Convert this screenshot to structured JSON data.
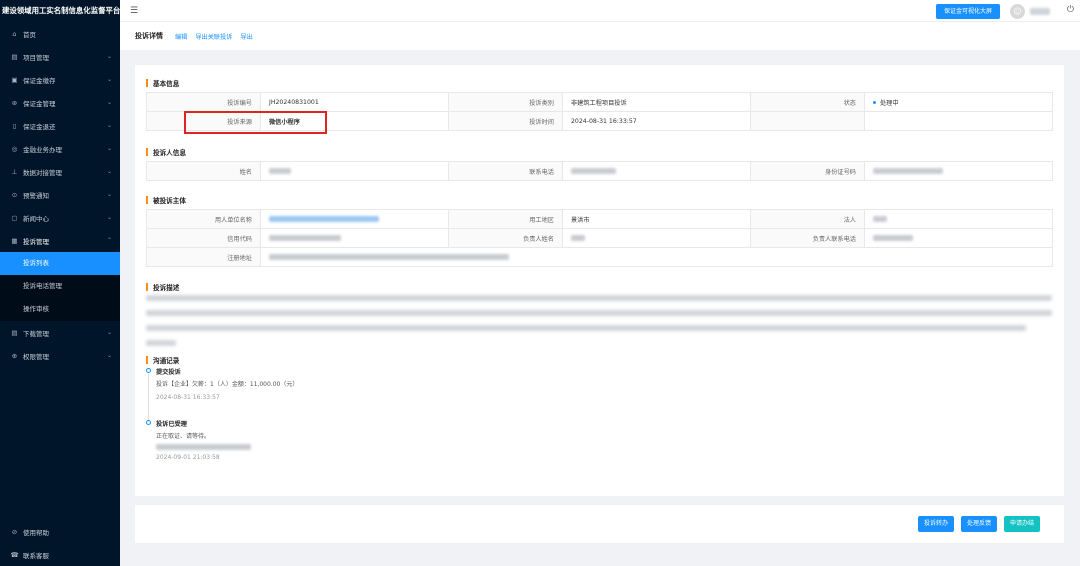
{
  "brand": "建设领域用工实名制信息化监督平台",
  "sidebar": {
    "items": [
      {
        "icon": "home-icon",
        "glyph": "⌂",
        "label": "首页",
        "chevron": ""
      },
      {
        "icon": "project-icon",
        "glyph": "▤",
        "label": "项目管理",
        "chevron": "⌄"
      },
      {
        "icon": "deposit-icon",
        "glyph": "▣",
        "label": "保证金缴存",
        "chevron": "⌄"
      },
      {
        "icon": "deposit-manage-icon",
        "glyph": "⊛",
        "label": "保证金管理",
        "chevron": "⌄"
      },
      {
        "icon": "refund-icon",
        "glyph": "▯",
        "label": "保证金退还",
        "chevron": "⌄"
      },
      {
        "icon": "finance-icon",
        "glyph": "◎",
        "label": "金融业务办理",
        "chevron": "⌄"
      },
      {
        "icon": "data-icon",
        "glyph": "⊥",
        "label": "数据对接管理",
        "chevron": "⌄"
      },
      {
        "icon": "alert-icon",
        "glyph": "⊙",
        "label": "预警通知",
        "chevron": "⌄"
      },
      {
        "icon": "news-icon",
        "glyph": "▢",
        "label": "新闻中心",
        "chevron": "⌄"
      },
      {
        "icon": "complaint-icon",
        "glyph": "▦",
        "label": "投诉管理",
        "chevron": "⌃"
      }
    ],
    "sub_items": [
      {
        "label": "投诉列表",
        "active": true
      },
      {
        "label": "投诉电话管理",
        "active": false
      },
      {
        "label": "操作审核",
        "active": false
      }
    ],
    "items_after": [
      {
        "icon": "download-icon",
        "glyph": "▤",
        "label": "下载管理",
        "chevron": "⌄"
      },
      {
        "icon": "permission-icon",
        "glyph": "⊕",
        "label": "权限管理",
        "chevron": "⌄"
      }
    ],
    "bottom": [
      {
        "icon": "help-icon",
        "glyph": "⊘",
        "label": "使用帮助"
      },
      {
        "icon": "service-icon",
        "glyph": "☎",
        "label": "联系客服"
      }
    ]
  },
  "header": {
    "big_screen_label": "保证金可视化大屏",
    "avatar_glyph": "☺"
  },
  "crumb": {
    "title": "投诉详情",
    "links": [
      "编辑",
      "导出关联投诉",
      "导出"
    ]
  },
  "basic": {
    "title": "基本信息",
    "rows": [
      [
        {
          "label": "投诉编号",
          "value": "JH20240831001"
        },
        {
          "label": "投诉类别",
          "value": "非建筑工程项目投诉"
        },
        {
          "label": "状态",
          "value": "处理中"
        }
      ],
      [
        {
          "label": "投诉来源",
          "value": "微信小程序"
        },
        {
          "label": "投诉时间",
          "value": "2024-08-31 16:33:57"
        },
        {
          "label": "",
          "value": ""
        }
      ]
    ]
  },
  "complainant": {
    "title": "投诉人信息",
    "labels": [
      "姓名",
      "联系电话",
      "身份证号码"
    ]
  },
  "respondent": {
    "title": "被投诉主体",
    "labels_row1": [
      "用人单位名称",
      "用工地区",
      "法人"
    ],
    "labels_row2": [
      "信用代码",
      "负责人姓名",
      "负责人联系电话"
    ],
    "label_row3": "注册地址",
    "region_value": "景洪市"
  },
  "description": {
    "title": "投诉描述"
  },
  "communication": {
    "title": "沟通记录",
    "records": [
      {
        "title": "提交投诉",
        "text": "投诉【企业】欠薪：1（人）金额：11,000.00（元）",
        "time": "2024-08-31 16:33:57"
      },
      {
        "title": "投诉已受理",
        "text": "正在取证、请等待。",
        "time": "2024-09-01 21:03:58"
      }
    ]
  },
  "actions": {
    "transfer": "投诉转办",
    "feedback": "处理反馈",
    "apply": "申请办结"
  },
  "colors": {
    "accent": "#1890ff",
    "sidebar_bg": "#001529",
    "highlight": "#e02424",
    "section_marker": "#fa8c16"
  }
}
